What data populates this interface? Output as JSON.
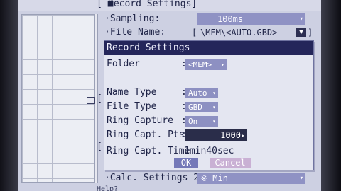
{
  "header": {
    "marker": "[ ■",
    "title": "Record Settings]"
  },
  "main": {
    "sampling": {
      "label": "·Sampling:",
      "value": "100ms",
      "arrow": "▾"
    },
    "file_name": {
      "label": "·File Name:",
      "open_bracket": "[",
      "value": "\\MEM\\<AUTO.GBD>",
      "close_bracket": "]",
      "dropdown": "▼"
    },
    "calc_settings": {
      "label": "·Calc. Settings 2:",
      "value": "※ Min",
      "arrow": "▾"
    },
    "help": "Help?"
  },
  "dialog": {
    "title": "Record Settings",
    "folder": {
      "label": "Folder",
      "colon": ":",
      "value": "<MEM>",
      "arrow": "▾"
    },
    "name_type": {
      "label": "Name Type",
      "colon": ":",
      "value": "Auto",
      "arrow": "▾"
    },
    "file_type": {
      "label": "File Type",
      "colon": ":",
      "value": "GBD",
      "arrow": "▾"
    },
    "ring_capture": {
      "label": "Ring Capture",
      "colon": ":",
      "value": "On",
      "arrow": "▾"
    },
    "ring_capt_pts": {
      "label": "Ring Capt. Pts.",
      "colon": ":",
      "value": "1000",
      "arrow": "▸"
    },
    "ring_capt_time": {
      "label": "Ring Capt. Time:",
      "value": "1min40sec"
    },
    "ok_label": "OK",
    "cancel_label": "Cancel"
  },
  "side_brackets": {
    "left_mid": "[",
    "left_low": "["
  },
  "colors": {
    "dialog_title_bg": "#24265a",
    "pill_bg": "#8d90c2",
    "ok_bg": "#7478b8",
    "cancel_bg": "#c9b0d4"
  }
}
